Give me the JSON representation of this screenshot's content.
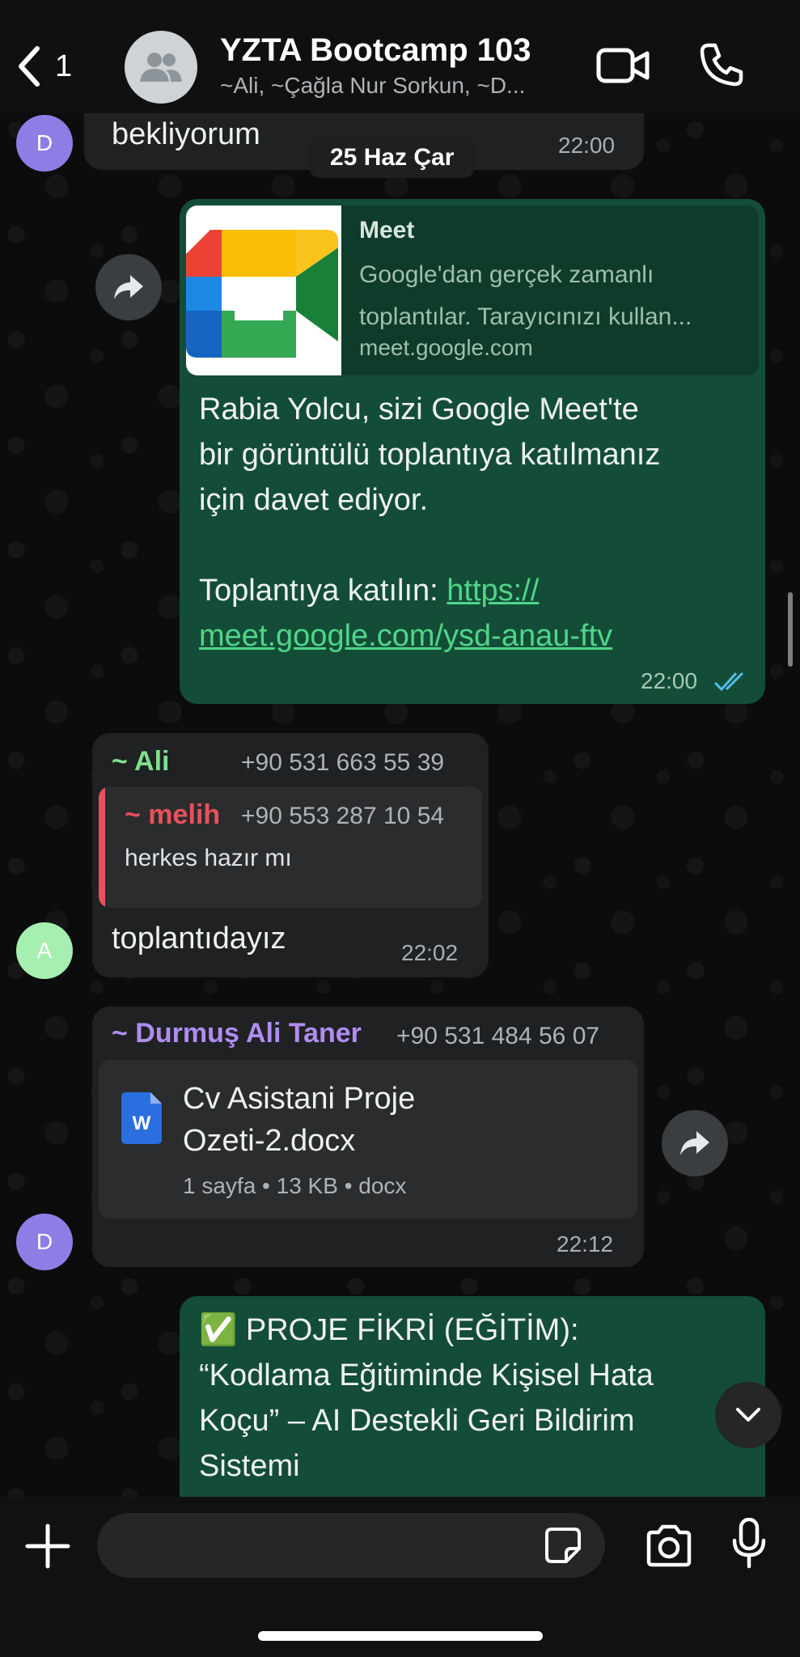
{
  "header": {
    "back_count": "1",
    "title": "YZTA Bootcamp 103",
    "subtitle": "~Ali, ~Çağla Nur Sorkun, ~D..."
  },
  "date_chip": "25 Haz Çar",
  "messages": [
    {
      "avatar": "D",
      "text": "bekliyorum",
      "time": "22:00"
    },
    {
      "link_preview": {
        "title": "Meet",
        "description": "Google'dan gerçek zamanlı toplantılar. Tarayıcınızı kullan...",
        "domain": "meet.google.com"
      },
      "text_lines": [
        "Rabia Yolcu, sizi Google Meet'te",
        "bir görüntülü toplantıya katılmanız",
        "için davet ediyor."
      ],
      "join_label": "Toplantıya katılın: ",
      "link_part1": "https://",
      "link_part2": "meet.google.com/ysd-anau-ftv",
      "time": "22:00"
    },
    {
      "avatar": "A",
      "sender": "~ Ali",
      "phone": "+90 531 663 55 39",
      "quote": {
        "sender": "~ melih",
        "phone": "+90 553 287 10 54",
        "text": "herkes hazır mı"
      },
      "text": "toplantıdayız",
      "time": "22:02"
    },
    {
      "avatar": "D",
      "sender": "~ Durmuş Ali Taner",
      "phone": "+90 531 484 56 07",
      "document": {
        "name_line1": "Cv Asistani Proje",
        "name_line2": "Ozeti-2.docx",
        "meta": "1 sayfa • 13 KB • docx"
      },
      "time": "22:12"
    },
    {
      "text_lines": [
        "✅ PROJE FİKRİ (EĞİTİM):",
        "“Kodlama Eğitiminde Kişisel Hata",
        "Koçu” – AI Destekli Geri Bildirim",
        "Sistemi"
      ]
    }
  ],
  "colors": {
    "out_bubble": "#144d37",
    "in_bubble": "#1f2123",
    "ali_name": "#7ee08a",
    "melih_name": "#e8505b",
    "durmus_name": "#b08cf2",
    "link": "#4fd58a",
    "read_ticks": "#53bdeb"
  }
}
